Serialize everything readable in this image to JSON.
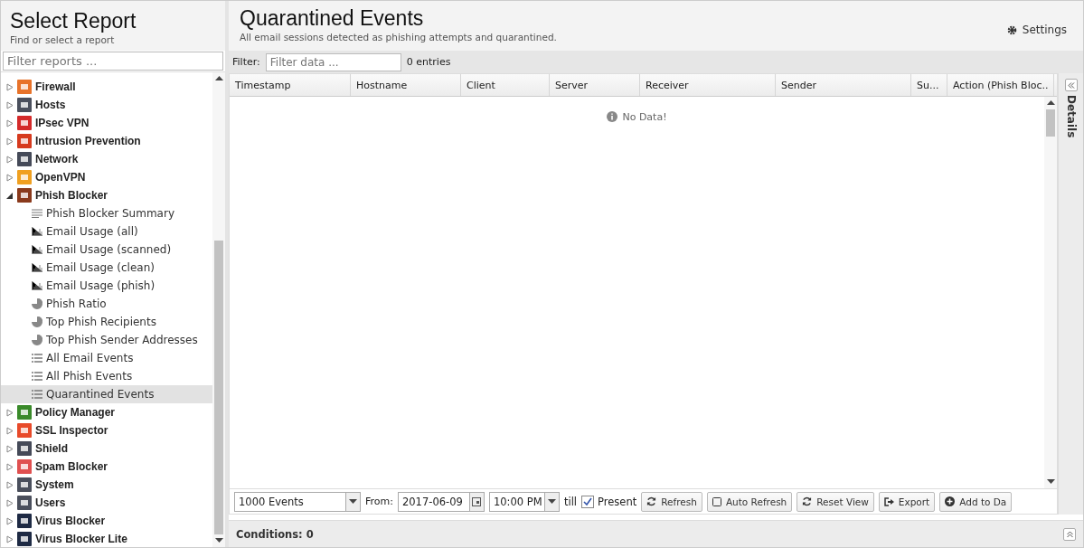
{
  "sidebar": {
    "title": "Select Report",
    "subtitle": "Find or select a report",
    "filter": {
      "placeholder": "Filter reports ..."
    },
    "items": [
      {
        "label": "Firewall",
        "color": "#e8732a",
        "expanded": false,
        "selected": false
      },
      {
        "label": "Hosts",
        "color": "#4a4f5c",
        "expanded": false,
        "selected": false
      },
      {
        "label": "IPsec VPN",
        "color": "#d42a2a",
        "expanded": false,
        "selected": false
      },
      {
        "label": "Intrusion Prevention",
        "color": "#d63a1e",
        "expanded": false,
        "selected": false
      },
      {
        "label": "Network",
        "color": "#454a58",
        "expanded": false,
        "selected": false
      },
      {
        "label": "OpenVPN",
        "color": "#f0a020",
        "expanded": false,
        "selected": false
      },
      {
        "label": "Phish Blocker",
        "color": "#8a3a1c",
        "expanded": true,
        "selected": false,
        "children": [
          {
            "label": "Phish Blocker Summary",
            "kind": "summary",
            "selected": false
          },
          {
            "label": "Email Usage (all)",
            "kind": "bar",
            "selected": false
          },
          {
            "label": "Email Usage (scanned)",
            "kind": "bar",
            "selected": false
          },
          {
            "label": "Email Usage (clean)",
            "kind": "bar",
            "selected": false
          },
          {
            "label": "Email Usage (phish)",
            "kind": "bar",
            "selected": false
          },
          {
            "label": "Phish Ratio",
            "kind": "pie",
            "selected": false
          },
          {
            "label": "Top Phish Recipients",
            "kind": "pie",
            "selected": false
          },
          {
            "label": "Top Phish Sender Addresses",
            "kind": "pie",
            "selected": false
          },
          {
            "label": "All Email Events",
            "kind": "list",
            "selected": false
          },
          {
            "label": "All Phish Events",
            "kind": "list",
            "selected": false
          },
          {
            "label": "Quarantined Events",
            "kind": "list",
            "selected": true
          }
        ]
      },
      {
        "label": "Policy Manager",
        "color": "#3a8a2a",
        "expanded": false,
        "selected": false
      },
      {
        "label": "SSL Inspector",
        "color": "#e84a2a",
        "expanded": false,
        "selected": false
      },
      {
        "label": "Shield",
        "color": "#454a58",
        "expanded": false,
        "selected": false
      },
      {
        "label": "Spam Blocker",
        "color": "#e05050",
        "expanded": false,
        "selected": false
      },
      {
        "label": "System",
        "color": "#4a4f5c",
        "expanded": false,
        "selected": false
      },
      {
        "label": "Users",
        "color": "#4a4f5c",
        "expanded": false,
        "selected": false
      },
      {
        "label": "Virus Blocker",
        "color": "#1e2a44",
        "expanded": false,
        "selected": false
      },
      {
        "label": "Virus Blocker Lite",
        "color": "#1e2a44",
        "expanded": false,
        "selected": false
      }
    ]
  },
  "report": {
    "title": "Quarantined Events",
    "subtitle": "All email sessions detected as phishing attempts and quarantined.",
    "settings": "Settings",
    "filter": {
      "label": "Filter:",
      "placeholder": "Filter data ...",
      "count": "0 entries"
    },
    "table": {
      "columns": [
        "Timestamp",
        "Hostname",
        "Client",
        "Server",
        "Receiver",
        "Sender",
        "Su...",
        "Action (Phish Bloc.."
      ],
      "empty": "No Data!"
    },
    "details": "Details",
    "toolbar": {
      "limit": "1000 Events",
      "from_label": "From:",
      "date": "2017-06-09",
      "time": "10:00 PM",
      "till_label": "till",
      "present": {
        "label": "Present",
        "checked": true
      },
      "buttons": [
        {
          "label": "Refresh",
          "kind": "refresh"
        },
        {
          "label": "Auto Refresh",
          "kind": "toggle"
        },
        {
          "label": "Reset View",
          "kind": "refresh"
        },
        {
          "label": "Export",
          "kind": "export"
        },
        {
          "label": "Add to Da",
          "kind": "add"
        }
      ]
    },
    "conditions": "Conditions: 0"
  }
}
